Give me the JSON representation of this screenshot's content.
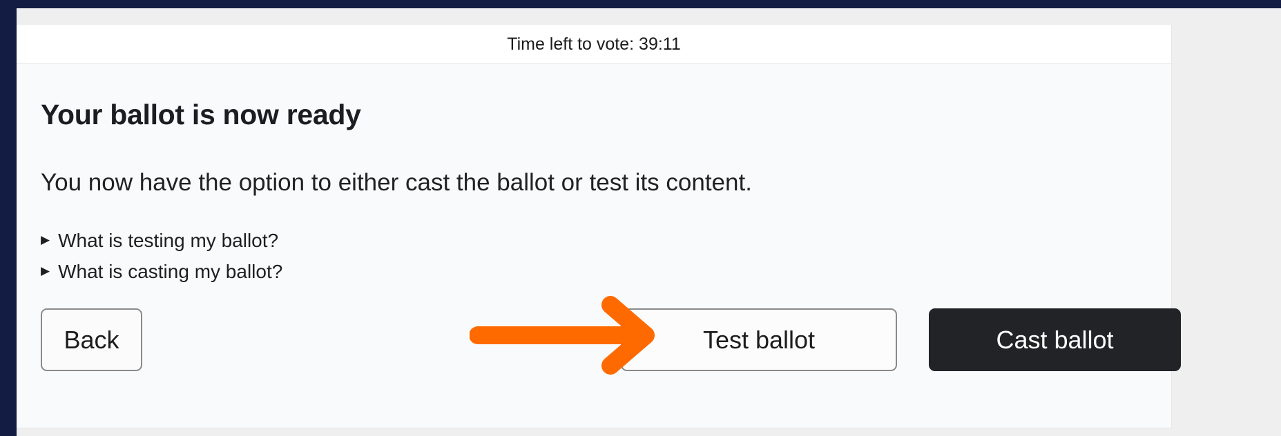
{
  "timer": {
    "text": "Time left to vote: 39:11"
  },
  "ballot": {
    "title": "Your ballot is now ready",
    "lead": "You now have the option to either cast the ballot or test its content.",
    "disclosures": [
      {
        "label": "What is testing my ballot?"
      },
      {
        "label": "What is casting my ballot?"
      }
    ]
  },
  "actions": {
    "back_label": "Back",
    "test_label": "Test ballot",
    "cast_label": "Cast ballot"
  },
  "annotation": {
    "arrow_color": "#ff6a00",
    "arrow_icon": "arrow-right-icon"
  },
  "colors": {
    "page_background": "#131d44",
    "primary_button": "#212326"
  }
}
